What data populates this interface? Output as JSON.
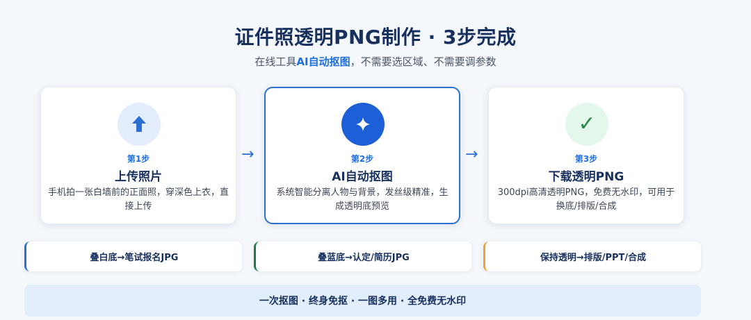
{
  "header": {
    "title": "证件照透明PNG制作 · 3步完成",
    "subtitle_prefix": "在线工具",
    "subtitle_highlight": "AI自动抠图",
    "subtitle_suffix": "，不需要选区域、不需要调参数",
    "accent_color": "#1f6fe0"
  },
  "steps": [
    {
      "step_label": "第1步",
      "title": "上传照片",
      "description": "手机拍一张白墙前的正面照，穿深色上衣，直接上传",
      "icon": "upload-arrow-icon"
    },
    {
      "step_label": "第2步",
      "title": "AI自动抠图",
      "description": "系统智能分离人物与背景，发丝级精准，生成透明底预览",
      "icon": "sparkle-icon"
    },
    {
      "step_label": "第3步",
      "title": "下载透明PNG",
      "description": "300dpi高清透明PNG，免费无水印，可用于换底/排版/合成",
      "icon": "check-icon",
      "icon_glyph": "✓"
    }
  ],
  "arrows": [
    "→",
    "→"
  ],
  "options": [
    {
      "label": "叠白底→笔试报名JPG",
      "color": "#2a6fd1"
    },
    {
      "label": "叠蓝底→认定/简历JPG",
      "color": "#1f7a45"
    },
    {
      "label": "保持透明→排版/PPT/合成",
      "color": "#f0a236"
    }
  ],
  "footer": {
    "text": "一次抠图 · 终身免抠 · 一图多用 · 全免费无水印"
  }
}
